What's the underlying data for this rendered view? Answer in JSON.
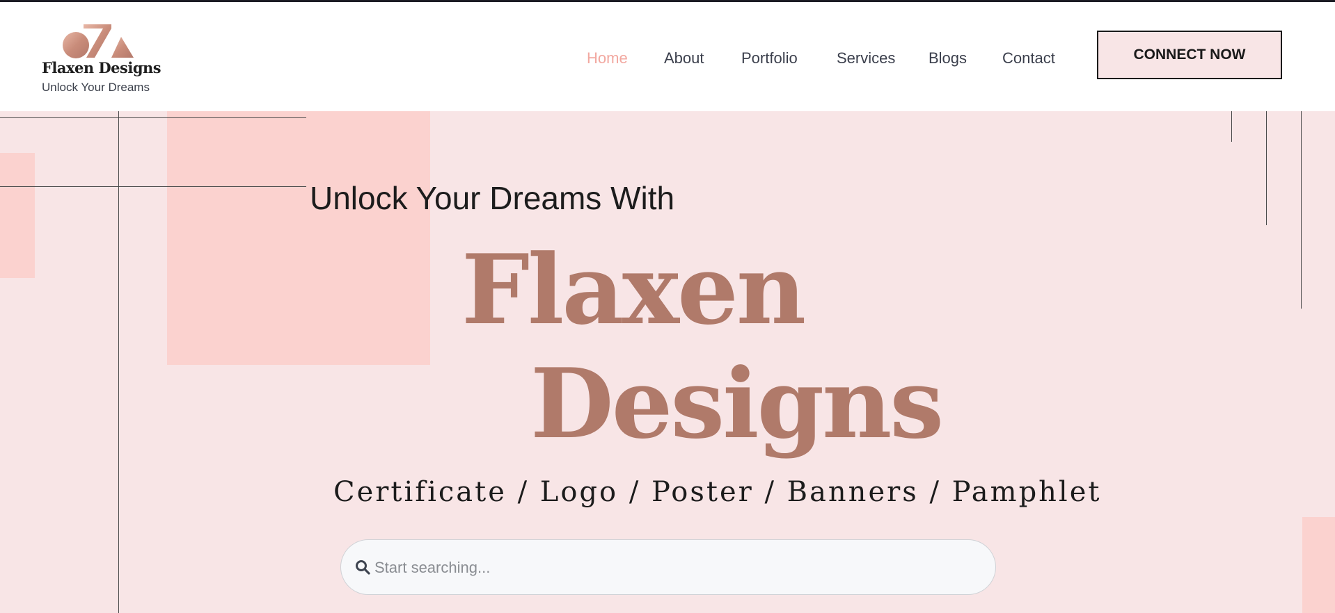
{
  "brand": {
    "name": "Flaxen Designs",
    "tagline": "Unlock Your Dreams",
    "logo_colors": [
      "#c98c7a",
      "#e8b7a6",
      "#b3786a"
    ]
  },
  "nav": {
    "items": [
      {
        "label": "Home",
        "active": true
      },
      {
        "label": "About",
        "active": false
      },
      {
        "label": "Portfolio",
        "active": false
      },
      {
        "label": "Services",
        "active": false
      },
      {
        "label": "Blogs",
        "active": false
      },
      {
        "label": "Contact",
        "active": false
      }
    ],
    "cta_label": "CONNECT NOW",
    "active_color": "#f2a8a0"
  },
  "hero": {
    "subtitle": "Unlock Your Dreams With",
    "title_line1": "Flaxen",
    "title_line2": "Designs",
    "categories": "Certificate / Logo / Poster / Banners / Pamphlet",
    "title_color": "#b07a6a",
    "background_color": "#f8e5e6",
    "accent_block_color": "#fbd2cf"
  },
  "search": {
    "placeholder": "Start searching...",
    "value": "",
    "icon": "search-icon"
  }
}
